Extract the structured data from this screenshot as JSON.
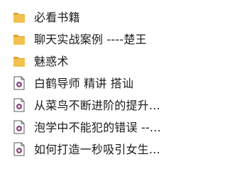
{
  "colors": {
    "folder": "#f2c14e",
    "folder_dark": "#dca534",
    "file_border": "#5a5a5a",
    "file_accent": "#8a4c7d",
    "text": "#1a1a1a"
  },
  "items": [
    {
      "type": "folder",
      "icon": "folder-icon",
      "label": "必看书籍"
    },
    {
      "type": "folder",
      "icon": "folder-icon",
      "label": "聊天实战案例  ----楚王"
    },
    {
      "type": "folder",
      "icon": "folder-icon",
      "label": "魅惑术"
    },
    {
      "type": "file",
      "icon": "media-file-icon",
      "label": "白鹤导师 精讲   搭讪"
    },
    {
      "type": "file",
      "icon": "media-file-icon",
      "label": "从菜鸟不断进阶的提升..."
    },
    {
      "type": "file",
      "icon": "media-file-icon",
      "label": "泡学中不能犯的错误 --..."
    },
    {
      "type": "file",
      "icon": "media-file-icon",
      "label": "如何打造一秒吸引女生..."
    }
  ]
}
